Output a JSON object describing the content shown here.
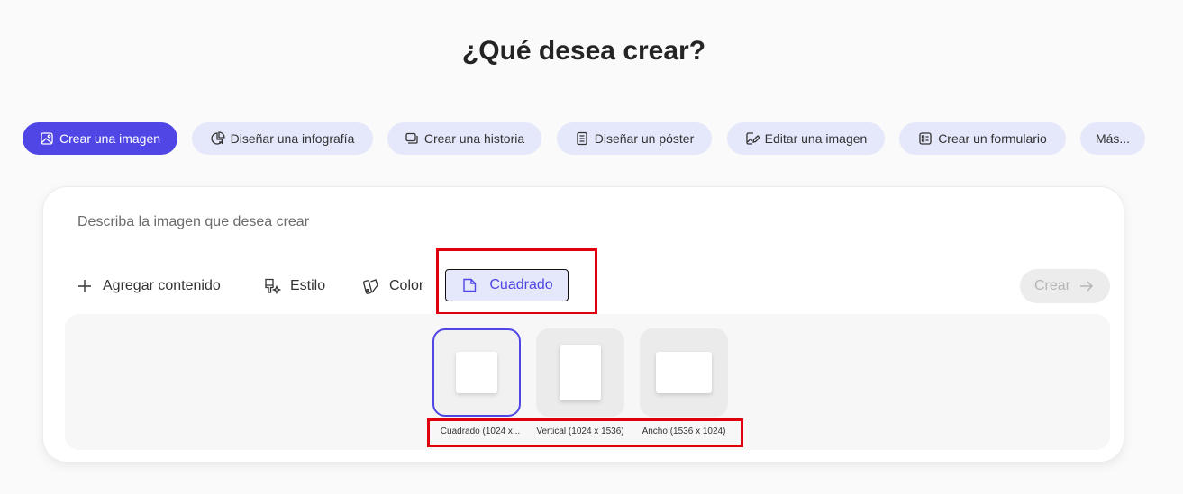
{
  "page": {
    "title": "¿Qué desea crear?"
  },
  "chips": [
    {
      "label": "Crear una imagen",
      "icon": "image-icon",
      "active": true
    },
    {
      "label": "Diseñar una infografía",
      "icon": "infographic-icon",
      "active": false
    },
    {
      "label": "Crear una historia",
      "icon": "story-icon",
      "active": false
    },
    {
      "label": "Diseñar un póster",
      "icon": "poster-icon",
      "active": false
    },
    {
      "label": "Editar una imagen",
      "icon": "edit-image-icon",
      "active": false
    },
    {
      "label": "Crear un formulario",
      "icon": "form-icon",
      "active": false
    },
    {
      "label": "Más...",
      "active": false
    }
  ],
  "composer": {
    "placeholder": "Describa la imagen que desea crear",
    "add_content_label": "Agregar contenido",
    "style_label": "Estilo",
    "color_label": "Color",
    "aspect_label": "Cuadrado",
    "create_label": "Crear"
  },
  "aspect_options": [
    {
      "label": "Cuadrado (1024 x...",
      "selected": true
    },
    {
      "label": "Vertical (1024 x 1536)",
      "selected": false
    },
    {
      "label": "Ancho (1536 x 1024)",
      "selected": false
    }
  ],
  "colors": {
    "accent": "#4f46e5",
    "chip_bg": "#e5e8fb",
    "highlight": "#e0000d"
  }
}
